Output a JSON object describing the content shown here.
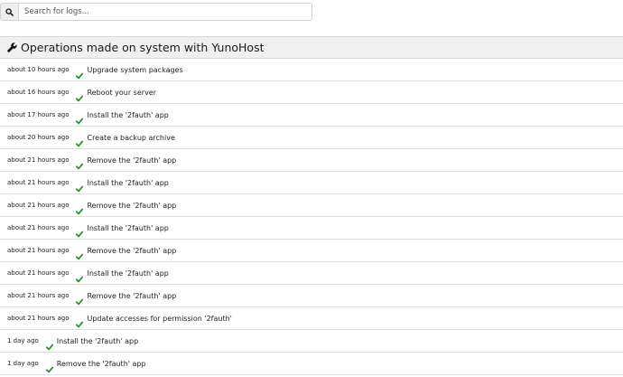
{
  "search": {
    "placeholder": "Search for logs...",
    "icon": "search-icon"
  },
  "panel": {
    "title": "Operations made on system with YunoHost",
    "icon": "wrench-icon"
  },
  "colors": {
    "success": "#2e8b2e",
    "header_bg": "#f0f0f0"
  },
  "logs": [
    {
      "time": "about 10 hours ago",
      "description": "Upgrade system packages",
      "status": "success"
    },
    {
      "time": "about 16 hours ago",
      "description": "Reboot your server",
      "status": "success"
    },
    {
      "time": "about 17 hours ago",
      "description": "Install the '2fauth' app",
      "status": "success"
    },
    {
      "time": "about 20 hours ago",
      "description": "Create a backup archive",
      "status": "success"
    },
    {
      "time": "about 21 hours ago",
      "description": "Remove the '2fauth' app",
      "status": "success"
    },
    {
      "time": "about 21 hours ago",
      "description": "Install the '2fauth' app",
      "status": "success"
    },
    {
      "time": "about 21 hours ago",
      "description": "Remove the '2fauth' app",
      "status": "success"
    },
    {
      "time": "about 21 hours ago",
      "description": "Install the '2fauth' app",
      "status": "success"
    },
    {
      "time": "about 21 hours ago",
      "description": "Remove the '2fauth' app",
      "status": "success"
    },
    {
      "time": "about 21 hours ago",
      "description": "Install the '2fauth' app",
      "status": "success"
    },
    {
      "time": "about 21 hours ago",
      "description": "Remove the '2fauth' app",
      "status": "success"
    },
    {
      "time": "about 21 hours ago",
      "description": "Update accesses for permission '2fauth'",
      "status": "success"
    },
    {
      "time": "1 day ago",
      "description": "Install the '2fauth' app",
      "status": "success"
    },
    {
      "time": "1 day ago",
      "description": "Remove the '2fauth' app",
      "status": "success"
    }
  ]
}
